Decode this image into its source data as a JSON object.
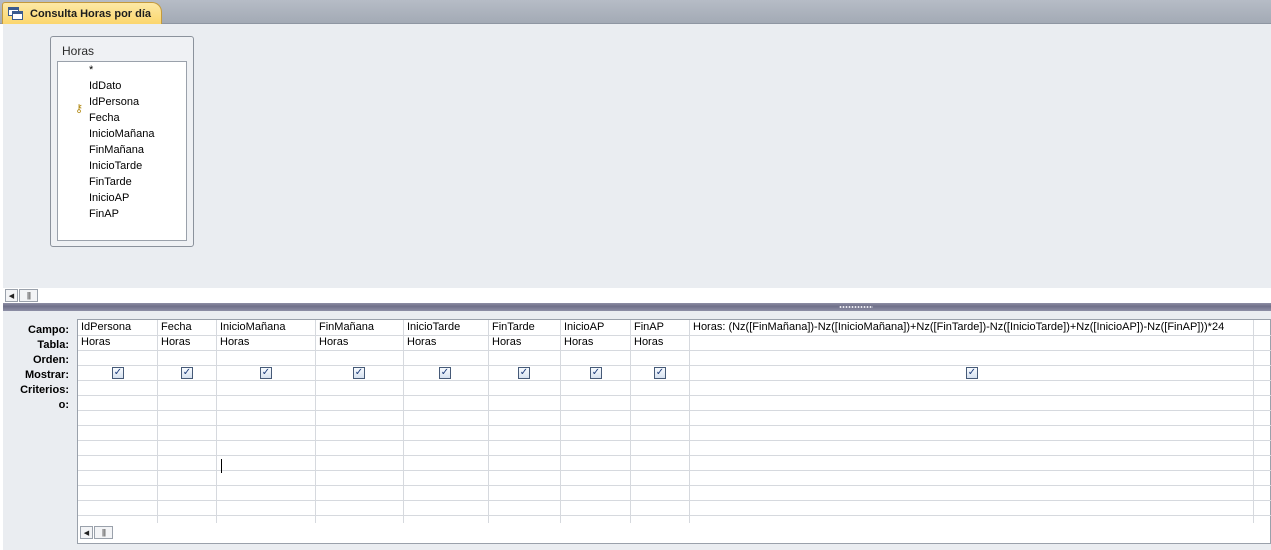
{
  "tab": {
    "title": "Consulta Horas por día",
    "icon": "query-icon"
  },
  "table": {
    "title": "Horas",
    "fields": [
      "*",
      "IdDato",
      "IdPersona",
      "Fecha",
      "InicioMañana",
      "FinMañana",
      "InicioTarde",
      "FinTarde",
      "InicioAP",
      "FinAP"
    ],
    "primary_key": "IdDato"
  },
  "grid": {
    "row_labels": [
      "Campo:",
      "Tabla:",
      "Orden:",
      "Mostrar:",
      "Criterios:",
      "o:"
    ],
    "columns": [
      {
        "campo": "IdPersona",
        "tabla": "Horas",
        "mostrar": true
      },
      {
        "campo": "Fecha",
        "tabla": "Horas",
        "mostrar": true
      },
      {
        "campo": "InicioMañana",
        "tabla": "Horas",
        "mostrar": true
      },
      {
        "campo": "FinMañana",
        "tabla": "Horas",
        "mostrar": true
      },
      {
        "campo": "InicioTarde",
        "tabla": "Horas",
        "mostrar": true
      },
      {
        "campo": "FinTarde",
        "tabla": "Horas",
        "mostrar": true
      },
      {
        "campo": "InicioAP",
        "tabla": "Horas",
        "mostrar": true
      },
      {
        "campo": "FinAP",
        "tabla": "Horas",
        "mostrar": true
      },
      {
        "campo": "Horas: (Nz([FinMañana])-Nz([InicioMañana])+Nz([FinTarde])-Nz([InicioTarde])+Nz([InicioAP])-Nz([FinAP]))*24",
        "tabla": "",
        "mostrar": true
      }
    ]
  },
  "colors": {
    "tab_active": "#fbd66d",
    "pane_bg": "#eaedf1",
    "splitter": "#6f7089"
  }
}
